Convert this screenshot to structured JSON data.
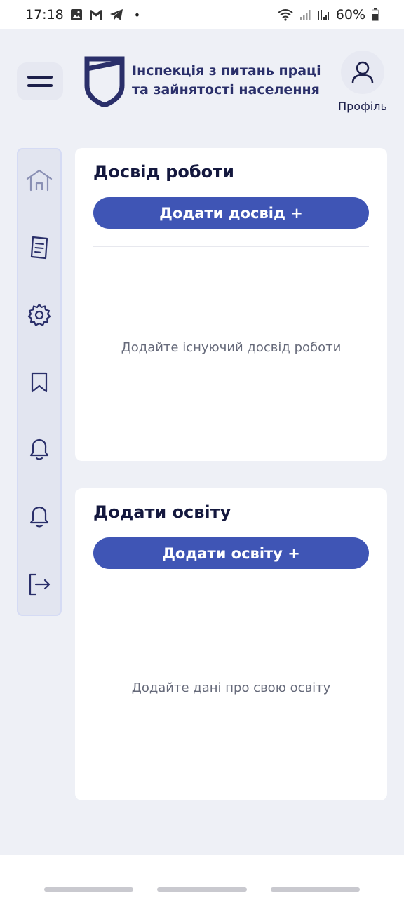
{
  "status_bar": {
    "time": "17:18",
    "battery": "60%",
    "dot": "•"
  },
  "header": {
    "org_title_line1": "Інспекція з питань праці",
    "org_title_line2": "та зайнятості населення",
    "profile_label": "Профіль"
  },
  "sidebar": {
    "items": [
      {
        "icon": "home-icon"
      },
      {
        "icon": "document-icon"
      },
      {
        "icon": "gear-icon"
      },
      {
        "icon": "bookmark-icon"
      },
      {
        "icon": "bell-icon"
      },
      {
        "icon": "bell-icon"
      },
      {
        "icon": "logout-icon"
      }
    ]
  },
  "experience": {
    "title": "Досвід роботи",
    "button": "Додати досвід +",
    "empty": "Додайте існуючий досвід роботи"
  },
  "education": {
    "title": "Додати освіту",
    "button": "Додати освіту +",
    "empty": "Додайте дані про свою освіту"
  },
  "colors": {
    "accent": "#3f55b5",
    "background": "#eef0f6",
    "brand_dark": "#2a2f6a"
  }
}
